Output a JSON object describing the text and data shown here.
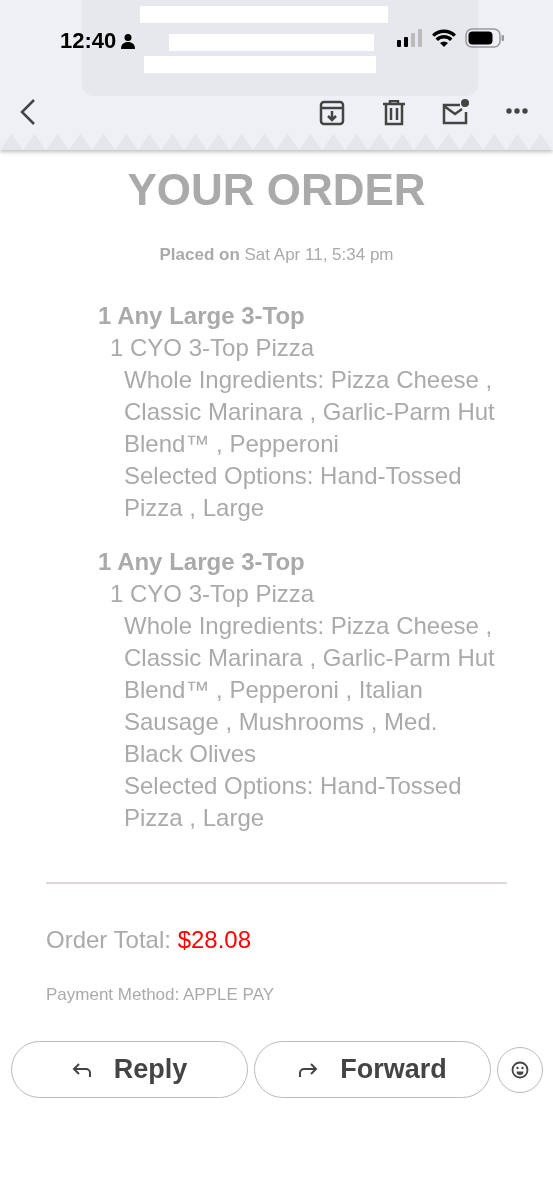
{
  "status_bar": {
    "time": "12:40"
  },
  "email": {
    "heading": "YOUR ORDER",
    "placed_label": "Placed on",
    "placed_date": "Sat Apr 11, 5:34 pm",
    "items": [
      {
        "title": "1 Any Large 3-Top",
        "product": "1 CYO 3-Top Pizza",
        "details": [
          "Whole Ingredients: Pizza Cheese , Classic Marinara , Garlic-Parm Hut Blend™ , Pepperoni",
          "Selected Options: Hand-Tossed Pizza , Large"
        ]
      },
      {
        "title": "1 Any Large 3-Top",
        "product": "1 CYO 3-Top Pizza",
        "details": [
          "Whole Ingredients: Pizza Cheese , Classic Marinara , Garlic-Parm Hut Blend™ , Pepperoni , Italian Sausage , Mushrooms , Med. Black Olives",
          "Selected Options: Hand-Tossed Pizza , Large"
        ]
      }
    ],
    "total_label": "Order Total:",
    "total": "$28.08",
    "payment": "Payment Method: APPLE PAY"
  },
  "actions": [
    "Reply",
    "Forward"
  ]
}
